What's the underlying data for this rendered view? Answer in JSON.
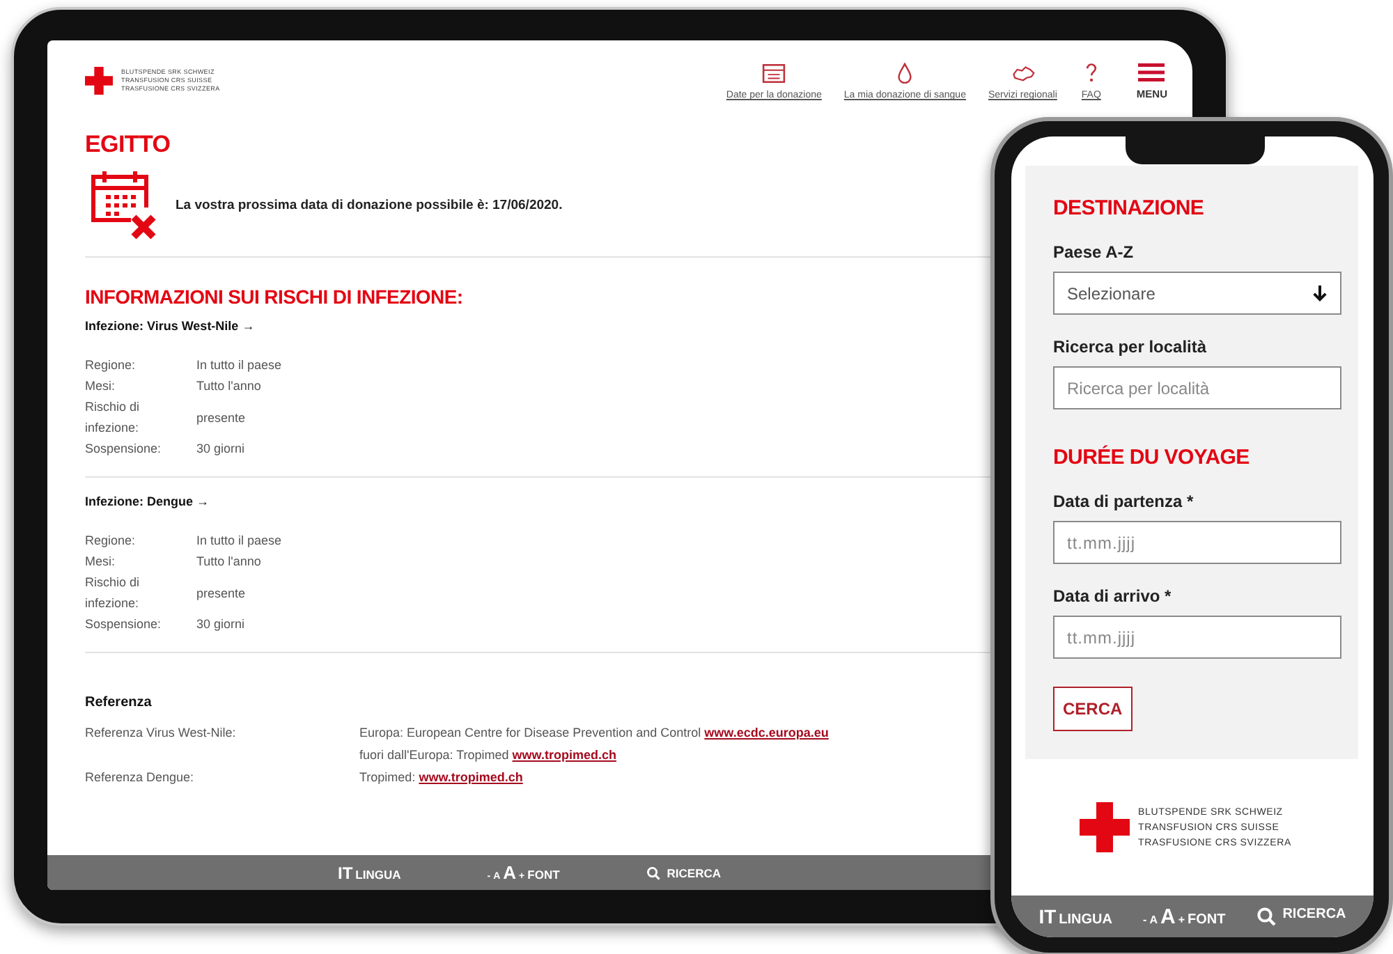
{
  "tablet": {
    "logo": {
      "lines": [
        "BLUTSPENDE SRK SCHWEIZ",
        "TRANSFUSION CRS SUISSE",
        "TRASFUSIONE CRS SVIZZERA"
      ]
    },
    "nav": [
      {
        "kind": "calendar",
        "label": "Date per la donazione"
      },
      {
        "kind": "drop",
        "label": "La mia donazione di sangue"
      },
      {
        "kind": "map",
        "label": "Servizi regionali"
      },
      {
        "kind": "question",
        "label": "FAQ"
      }
    ],
    "menu": {
      "label": "MENU"
    },
    "country_title": "EGITTO",
    "next_donation": "La vostra prossima data di donazione possibile è: 17/06/2020.",
    "risks_title": "INFORMAZIONI SUI RISCHI DI INFEZIONE:",
    "infections": [
      {
        "title": "Infezione: Virus West-Nile →",
        "rows": [
          {
            "label": "Regione:",
            "value": "In tutto il paese"
          },
          {
            "label": "Mesi:",
            "value": "Tutto l'anno"
          },
          {
            "label": "Rischio di infezione:",
            "value": "presente"
          },
          {
            "label": "Sospensione:",
            "value": "30 giorni"
          }
        ]
      },
      {
        "title": "Infezione: Dengue →",
        "rows": [
          {
            "label": "Regione:",
            "value": "In tutto il paese"
          },
          {
            "label": "Mesi:",
            "value": "Tutto l'anno"
          },
          {
            "label": "Rischio di infezione:",
            "value": "presente"
          },
          {
            "label": "Sospensione:",
            "value": "30 giorni"
          }
        ]
      }
    ],
    "reference": {
      "title": "Referenza",
      "rows": [
        {
          "label": "Referenza Virus West-Nile:",
          "lines": [
            {
              "text": "Europa: European Centre for Disease Prevention and Control",
              "link": "www.ecdc.europa.eu"
            },
            {
              "text": "fuori dall'Europa: Tropimed",
              "link": "www.tropimed.ch"
            }
          ]
        },
        {
          "label": "Referenza Dengue:",
          "lines": [
            {
              "text": "Tropimed:",
              "link": "www.tropimed.ch"
            }
          ]
        }
      ]
    },
    "bottom_bar": {
      "language": {
        "code": "IT",
        "label": "LINGUA"
      },
      "font": {
        "minus": "-",
        "small": "A",
        "big": "A",
        "plus": "+",
        "label": "FONT"
      },
      "search": {
        "label": "RICERCA"
      }
    }
  },
  "phone": {
    "destination_title": "DESTINAZIONE",
    "country": {
      "label": "Paese A-Z",
      "value": "Selezionare"
    },
    "location": {
      "label": "Ricerca per località",
      "placeholder": "Ricerca per località"
    },
    "trip_title": "DURÉE DU VOYAGE",
    "departure": {
      "label": "Data di partenza *",
      "placeholder": "tt.mm.jjjj"
    },
    "arrival": {
      "label": "Data di arrivo *",
      "placeholder": "tt.mm.jjjj"
    },
    "search_button": "CERCA",
    "logo": {
      "lines": [
        "BLUTSPENDE SRK SCHWEIZ",
        "TRANSFUSION CRS SUISSE",
        "TRASFUSIONE CRS SVIZZERA"
      ]
    },
    "bottom_bar": {
      "language": {
        "code": "IT",
        "label": "LINGUA"
      },
      "font": {
        "minus": "-",
        "small": "A",
        "big": "A",
        "plus": "+",
        "label": "FONT"
      },
      "search": {
        "label": "RICERCA"
      }
    }
  }
}
